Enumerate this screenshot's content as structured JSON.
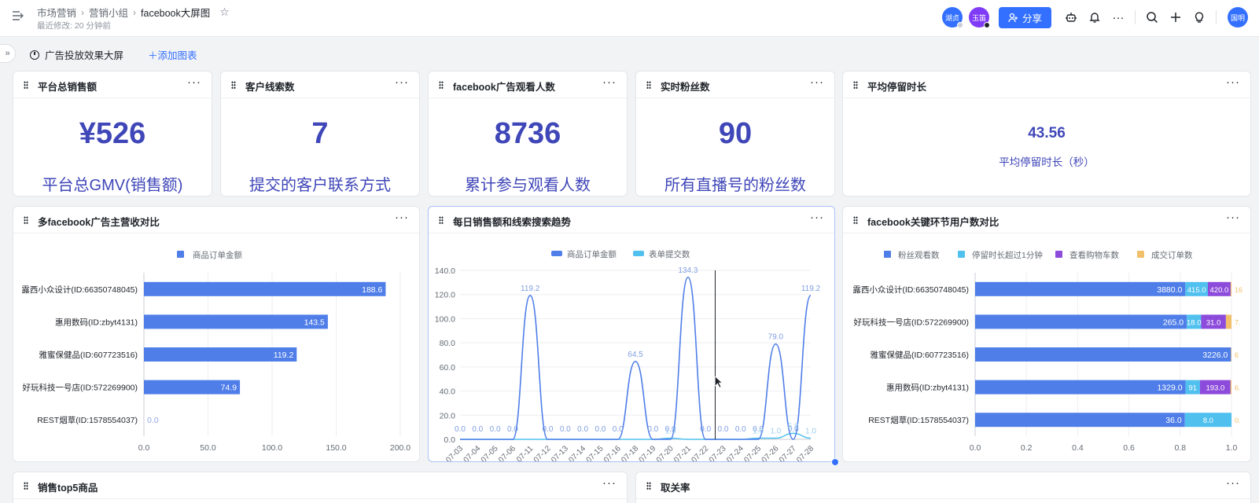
{
  "topbar": {
    "breadcrumbs": [
      "市场营销",
      "营销小组",
      "facebook大屏图"
    ],
    "last_modified": "最近修改: 20 分钟前",
    "collaborators": [
      {
        "name": "湖贞",
        "color": "#3370ff",
        "status_color": "#c9cdd4"
      },
      {
        "name": "玉笛",
        "color": "#7f3bf5",
        "status_color": "#1f2329"
      }
    ],
    "share_label": "分享",
    "user_avatar": "国明"
  },
  "subbar": {
    "dashboard_name": "广告投放效果大屏",
    "add_chart_label": "添加图表"
  },
  "kpis": [
    {
      "title": "平台总销售额",
      "value": "¥526",
      "caption": "平台总GMV(销售额)"
    },
    {
      "title": "客户线索数",
      "value": "7",
      "caption": "提交的客户联系方式"
    },
    {
      "title": "facebook广告观看人数",
      "value": "8736",
      "caption": "累计参与观看人数"
    },
    {
      "title": "实时粉丝数",
      "value": "90",
      "caption": "所有直播号的粉丝数"
    },
    {
      "title": "平均停留时长",
      "value": "43.56",
      "caption": "平均停留时长（秒）"
    }
  ],
  "cards": {
    "bar_title": "多facebook广告主营收对比",
    "line_title": "每日销售额和线索搜索趋势",
    "stack_title": "facebook关键环节用户数对比",
    "bottom_left_title": "销售top5商品",
    "bottom_right_title": "取关率"
  },
  "colors": {
    "accent": "#3370ff",
    "kpi_text": "#3f46b8",
    "series_blue": "#4f7ee8",
    "series_cyan": "#50c0ee",
    "series_purple": "#8d4bdb",
    "series_orange": "#f2c06a"
  },
  "chart_data": [
    {
      "type": "bar",
      "orientation": "horizontal",
      "categories": [
        "露西小众设计(ID:66350748045)",
        "惠用数码(ID:zbyt4131)",
        "雅蜜保健品(ID:607723516)",
        "好玩科技一号店(ID:572269900)",
        "REST烟草(ID:1578554037)"
      ],
      "series": [
        {
          "name": "商品订单金额",
          "values": [
            188.6,
            143.5,
            119.2,
            74.9,
            0.0
          ]
        }
      ],
      "xlim": [
        0,
        200
      ],
      "xticks": [
        "0.0",
        "50.0",
        "100.0",
        "150.0",
        "200.0"
      ],
      "legend": "top-center",
      "grid": true
    },
    {
      "type": "line",
      "x": [
        "07-03",
        "07-04",
        "07-05",
        "07-06",
        "07-11",
        "07-12",
        "07-13",
        "07-14",
        "07-15",
        "07-16",
        "07-18",
        "07-19",
        "07-20",
        "07-21",
        "07-22",
        "07-23",
        "07-24",
        "07-25",
        "07-26",
        "07-27",
        "07-28"
      ],
      "series": [
        {
          "name": "商品订单金额",
          "values": [
            0.0,
            0.0,
            0.0,
            0.0,
            119.2,
            0.0,
            0.0,
            0.0,
            0.0,
            0.0,
            64.5,
            0.0,
            0.0,
            134.3,
            0.0,
            0.0,
            0.0,
            0.0,
            79.0,
            0.0,
            119.2
          ]
        },
        {
          "name": "表单提交数",
          "values": [
            0,
            0,
            0,
            0,
            0,
            0,
            0,
            0,
            0,
            0,
            0,
            0,
            1.0,
            0,
            0,
            0,
            0,
            1.0,
            1.0,
            5.0,
            1.0
          ]
        }
      ],
      "ylim": [
        0,
        140
      ],
      "yticks": [
        "0.0",
        "20.0",
        "40.0",
        "60.0",
        "80.0",
        "100.0",
        "120.0",
        "140.0"
      ],
      "legend": "top-center",
      "grid": true
    },
    {
      "type": "bar",
      "orientation": "horizontal",
      "stacked": "percent",
      "categories": [
        "露西小众设计(ID:66350748045)",
        "好玩科技一号店(ID:572269900)",
        "雅蜜保健品(ID:607723516)",
        "惠用数码(ID:zbyt4131)",
        "REST烟草(ID:1578554037)"
      ],
      "series": [
        {
          "name": "粉丝观看数",
          "values": [
            3880.0,
            265.0,
            3226.0,
            1329.0,
            36.0
          ]
        },
        {
          "name": "停留时长超过1分钟",
          "values": [
            415.0,
            18.0,
            0,
            91.0,
            8.0
          ]
        },
        {
          "name": "查看购物车数",
          "values": [
            420.0,
            31.0,
            0,
            193.0,
            0
          ]
        },
        {
          "name": "成交订单数",
          "values": [
            16.0,
            7.0,
            6.0,
            6.0,
            0.0
          ]
        }
      ],
      "segment_labels": [
        [
          "3880.0",
          "415.0",
          "420.0",
          "16"
        ],
        [
          "265.0",
          "18.0",
          "31.0",
          "7."
        ],
        [
          "3226.0",
          "",
          "",
          "6"
        ],
        [
          "1329.0",
          "91",
          "193.0",
          "6."
        ],
        [
          "36.0",
          "8.0",
          "",
          "0."
        ]
      ],
      "xlim": [
        0,
        1
      ],
      "xticks": [
        "0.0",
        "0.2",
        "0.4",
        "0.6",
        "0.8",
        "1.0"
      ],
      "legend": "top-center",
      "grid": true
    }
  ]
}
